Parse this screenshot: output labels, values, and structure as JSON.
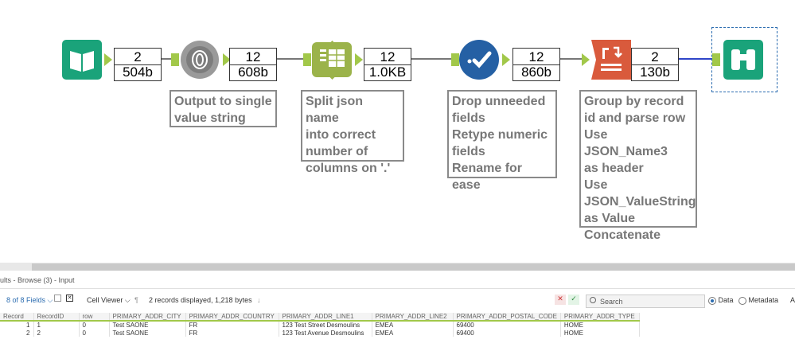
{
  "workflow": {
    "metrics": [
      {
        "count": "2",
        "size": "504b"
      },
      {
        "count": "12",
        "size": "608b"
      },
      {
        "count": "12",
        "size": "1.0KB"
      },
      {
        "count": "12",
        "size": "860b"
      },
      {
        "count": "2",
        "size": "130b"
      }
    ],
    "comments": [
      "Output to single\nvalue string",
      "Split json name\ninto correct\nnumber of\ncolumns on '.'",
      "Drop unneeded\nfields\nRetype numeric\nfields\nRename for ease",
      "Group by record\nid and parse row\nUse JSON_Name3\nas header\nUse\nJSON_ValueString\nas Value\nConcatenate"
    ],
    "colors": {
      "input_tool": "#1aa37a",
      "json_parse_tool": "#8c8c8c",
      "text_to_columns_tool": "#9bb34a",
      "select_tool": "#2560a4",
      "crosstab_tool": "#d95a3c",
      "browse_tool": "#1aa37a",
      "anchor": "#a2c84a"
    }
  },
  "results": {
    "title": "ults - Browse (3) - Input",
    "fields_label": "8 of 8 Fields",
    "viewer_label": "Cell Viewer",
    "records_info": "2 records displayed, 1,218 bytes",
    "search_placeholder": "Search",
    "data_label": "Data",
    "metadata_label": "Metadata",
    "trailing_label": "A",
    "columns": [
      "Record",
      "RecordID",
      "row",
      "PRIMARY_ADDR_CITY",
      "PRIMARY_ADDR_COUNTRY",
      "PRIMARY_ADDR_LINE1",
      "PRIMARY_ADDR_LINE2",
      "PRIMARY_ADDR_POSTAL_CODE",
      "PRIMARY_ADDR_TYPE"
    ],
    "rows": [
      [
        "1",
        "1",
        "0",
        "Test  SAONE",
        "FR",
        "123 Test Street  Desmoulins",
        "EMEA",
        "69400",
        "HOME"
      ],
      [
        "2",
        "2",
        "0",
        "Test SAONE",
        "FR",
        "123 Test Avenue Desmoulins",
        "EMEA",
        "69400",
        "HOME"
      ]
    ]
  }
}
